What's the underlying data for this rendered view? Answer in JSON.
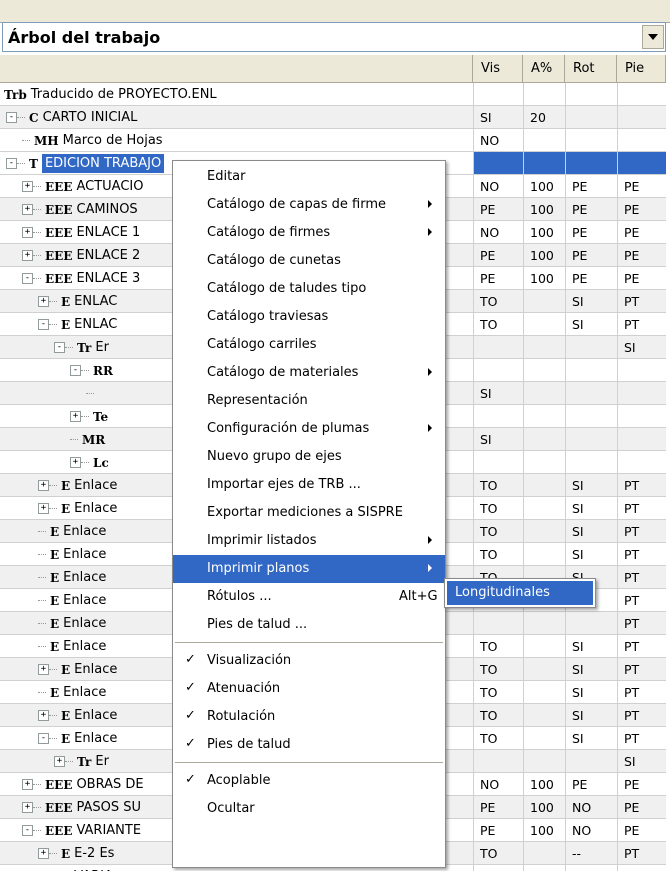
{
  "panel": {
    "title": "Árbol del trabajo"
  },
  "columns": [
    "Vis",
    "A%",
    "Rot",
    "Pie"
  ],
  "rows": [
    {
      "depth": 0,
      "exp": "",
      "icon": "Trb",
      "label": "Traducido de PROYECTO.ENL",
      "vis": "",
      "a": "",
      "rot": "",
      "pie": ""
    },
    {
      "depth": 1,
      "exp": "-",
      "icon": "C",
      "label": "CARTO INICIAL",
      "vis": "SI",
      "a": "20",
      "rot": "",
      "pie": ""
    },
    {
      "depth": 2,
      "exp": "",
      "icon": "MH",
      "label": "Marco de Hojas",
      "vis": "NO",
      "a": "",
      "rot": "",
      "pie": ""
    },
    {
      "depth": 1,
      "exp": "-",
      "icon": "T",
      "label": "EDICION TRABAJO",
      "vis": "",
      "a": "",
      "rot": "",
      "pie": "",
      "sel": true
    },
    {
      "depth": 2,
      "exp": "+",
      "icon": "EEE",
      "label": "ACTUACIO",
      "vis": "NO",
      "a": "100",
      "rot": "PE",
      "pie": "PE"
    },
    {
      "depth": 2,
      "exp": "+",
      "icon": "EEE",
      "label": "CAMINOS",
      "vis": "PE",
      "a": "100",
      "rot": "PE",
      "pie": "PE"
    },
    {
      "depth": 2,
      "exp": "+",
      "icon": "EEE",
      "label": "ENLACE 1",
      "vis": "NO",
      "a": "100",
      "rot": "PE",
      "pie": "PE"
    },
    {
      "depth": 2,
      "exp": "+",
      "icon": "EEE",
      "label": "ENLACE 2",
      "vis": "PE",
      "a": "100",
      "rot": "PE",
      "pie": "PE"
    },
    {
      "depth": 2,
      "exp": "-",
      "icon": "EEE",
      "label": "ENLACE 3",
      "vis": "PE",
      "a": "100",
      "rot": "PE",
      "pie": "PE"
    },
    {
      "depth": 3,
      "exp": "+",
      "icon": "E",
      "label": "ENLAC",
      "vis": "TO",
      "a": "",
      "rot": "SI",
      "pie": "PT"
    },
    {
      "depth": 3,
      "exp": "-",
      "icon": "E",
      "label": "ENLAC",
      "vis": "TO",
      "a": "",
      "rot": "SI",
      "pie": "PT"
    },
    {
      "depth": 4,
      "exp": "-",
      "icon": "Tr",
      "label": "Er",
      "vis": "",
      "a": "",
      "rot": "",
      "pie": "SI"
    },
    {
      "depth": 5,
      "exp": "-",
      "icon": "RR",
      "label": "",
      "vis": "",
      "a": "",
      "rot": "",
      "pie": ""
    },
    {
      "depth": 6,
      "exp": "",
      "icon": "",
      "label": "",
      "vis": "SI",
      "a": "",
      "rot": "",
      "pie": ""
    },
    {
      "depth": 5,
      "exp": "+",
      "icon": "Te",
      "label": "",
      "vis": "",
      "a": "",
      "rot": "",
      "pie": ""
    },
    {
      "depth": 5,
      "exp": "",
      "icon": "MR",
      "label": "",
      "vis": "SI",
      "a": "",
      "rot": "",
      "pie": ""
    },
    {
      "depth": 5,
      "exp": "+",
      "icon": "Lc",
      "label": "",
      "vis": "",
      "a": "",
      "rot": "",
      "pie": ""
    },
    {
      "depth": 3,
      "exp": "+",
      "icon": "E",
      "label": "Enlace",
      "vis": "TO",
      "a": "",
      "rot": "SI",
      "pie": "PT"
    },
    {
      "depth": 3,
      "exp": "+",
      "icon": "E",
      "label": "Enlace",
      "vis": "TO",
      "a": "",
      "rot": "SI",
      "pie": "PT"
    },
    {
      "depth": 3,
      "exp": "",
      "icon": "E",
      "label": "Enlace",
      "vis": "TO",
      "a": "",
      "rot": "SI",
      "pie": "PT"
    },
    {
      "depth": 3,
      "exp": "",
      "icon": "E",
      "label": "Enlace",
      "vis": "TO",
      "a": "",
      "rot": "SI",
      "pie": "PT"
    },
    {
      "depth": 3,
      "exp": "",
      "icon": "E",
      "label": "Enlace",
      "vis": "TO",
      "a": "",
      "rot": "SI",
      "pie": "PT"
    },
    {
      "depth": 3,
      "exp": "",
      "icon": "E",
      "label": "Enlace",
      "vis": "",
      "a": "",
      "rot": "",
      "pie": "PT"
    },
    {
      "depth": 3,
      "exp": "",
      "icon": "E",
      "label": "Enlace",
      "vis": "",
      "a": "",
      "rot": "",
      "pie": "PT"
    },
    {
      "depth": 3,
      "exp": "",
      "icon": "E",
      "label": "Enlace",
      "vis": "TO",
      "a": "",
      "rot": "SI",
      "pie": "PT"
    },
    {
      "depth": 3,
      "exp": "+",
      "icon": "E",
      "label": "Enlace",
      "vis": "TO",
      "a": "",
      "rot": "SI",
      "pie": "PT"
    },
    {
      "depth": 3,
      "exp": "",
      "icon": "E",
      "label": "Enlace",
      "vis": "TO",
      "a": "",
      "rot": "SI",
      "pie": "PT"
    },
    {
      "depth": 3,
      "exp": "+",
      "icon": "E",
      "label": "Enlace",
      "vis": "TO",
      "a": "",
      "rot": "SI",
      "pie": "PT"
    },
    {
      "depth": 3,
      "exp": "-",
      "icon": "E",
      "label": "Enlace",
      "vis": "TO",
      "a": "",
      "rot": "SI",
      "pie": "PT"
    },
    {
      "depth": 4,
      "exp": "+",
      "icon": "Tr",
      "label": "Er",
      "vis": "",
      "a": "",
      "rot": "",
      "pie": "SI"
    },
    {
      "depth": 2,
      "exp": "+",
      "icon": "EEE",
      "label": "OBRAS DE",
      "vis": "NO",
      "a": "100",
      "rot": "PE",
      "pie": "PE"
    },
    {
      "depth": 2,
      "exp": "+",
      "icon": "EEE",
      "label": "PASOS SU",
      "vis": "PE",
      "a": "100",
      "rot": "NO",
      "pie": "PE"
    },
    {
      "depth": 2,
      "exp": "-",
      "icon": "EEE",
      "label": "VARIANTE",
      "vis": "PE",
      "a": "100",
      "rot": "NO",
      "pie": "PE"
    },
    {
      "depth": 3,
      "exp": "+",
      "icon": "E",
      "label": "E-2 Es",
      "vis": "TO",
      "a": "",
      "rot": "--",
      "pie": "PT"
    },
    {
      "depth": 3,
      "exp": "+",
      "icon": "E",
      "label": "VARIA",
      "vis": "NO",
      "a": "",
      "rot": "--",
      "pie": "PT"
    }
  ],
  "context_menu": [
    {
      "label": "Editar",
      "arrow": false
    },
    {
      "label": "Catálogo de capas de firme",
      "arrow": true
    },
    {
      "label": "Catálogo de firmes",
      "arrow": true
    },
    {
      "label": "Catálogo de cunetas",
      "arrow": false
    },
    {
      "label": "Catálogo de taludes tipo",
      "arrow": false
    },
    {
      "label": "Catálogo traviesas",
      "arrow": false
    },
    {
      "label": "Catálogo carriles",
      "arrow": false
    },
    {
      "label": "Catálogo de materiales",
      "arrow": true
    },
    {
      "label": "Representación",
      "arrow": false
    },
    {
      "label": "Configuración de plumas",
      "arrow": true
    },
    {
      "label": "Nuevo grupo de ejes",
      "arrow": false
    },
    {
      "label": "Importar ejes de TRB ...",
      "arrow": false
    },
    {
      "label": "Exportar mediciones a SISPRE",
      "arrow": false
    },
    {
      "label": "Imprimir listados",
      "arrow": true
    },
    {
      "label": "Imprimir planos",
      "arrow": true,
      "hot": true
    },
    {
      "label": "Rótulos ...",
      "shortcut": "Alt+G",
      "arrow": false
    },
    {
      "label": "Pies de talud ...",
      "arrow": false
    },
    {
      "sep": true
    },
    {
      "label": "Visualización",
      "check": true
    },
    {
      "label": "Atenuación",
      "check": true
    },
    {
      "label": "Rotulación",
      "check": true
    },
    {
      "label": "Pies de talud",
      "check": true
    },
    {
      "sep": true
    },
    {
      "label": "Acoplable",
      "check": true
    },
    {
      "label": "Ocultar",
      "check": false
    }
  ],
  "submenu": {
    "item": "Longitudinales"
  }
}
